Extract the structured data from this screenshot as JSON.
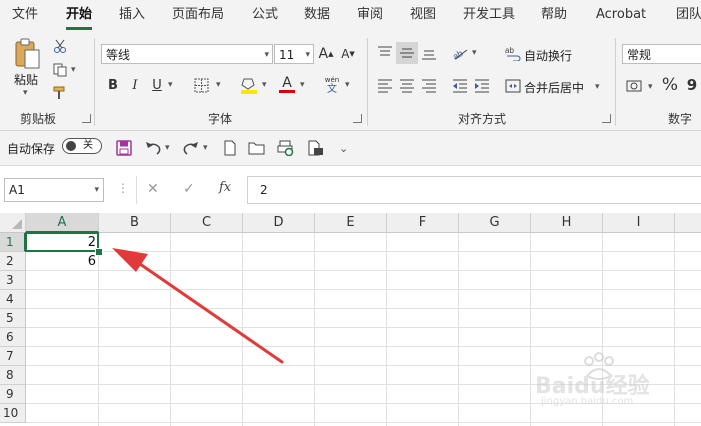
{
  "ribbon_tabs": [
    "文件",
    "开始",
    "插入",
    "页面布局",
    "公式",
    "数据",
    "审阅",
    "视图",
    "开发工具",
    "帮助",
    "Acrobat",
    "团队"
  ],
  "active_tab": "开始",
  "clipboard": {
    "paste_label": "粘贴",
    "group_label": "剪贴板"
  },
  "font": {
    "name": "等线",
    "size": "11",
    "group_label": "字体",
    "bold": "B",
    "italic": "I",
    "underline": "U",
    "font_color_glyph": "A",
    "wen_label": "wén",
    "wen_char": "文",
    "grow": "A",
    "shrink": "A"
  },
  "alignment": {
    "wrap_label": "自动换行",
    "merge_label": "合并后居中",
    "group_label": "对齐方式"
  },
  "number": {
    "format": "常规",
    "group_label": "数字",
    "percent": "%",
    "comma": "9"
  },
  "qat": {
    "autosave_label": "自动保存",
    "toggle_state": "关"
  },
  "formula_bar": {
    "name_box": "A1",
    "fx": "fx",
    "formula": "2",
    "cancel": "✕",
    "enter": "✓"
  },
  "columns": [
    "A",
    "B",
    "C",
    "D",
    "E",
    "F",
    "G",
    "H",
    "I"
  ],
  "rows": [
    "1",
    "2",
    "3",
    "4",
    "5",
    "6",
    "7",
    "8",
    "9",
    "10"
  ],
  "cells": [
    {
      "ref": "A1",
      "value": "2"
    },
    {
      "ref": "A2",
      "value": "6"
    }
  ],
  "colors": {
    "accent": "#217346",
    "arrow": "#e03a3a",
    "highlight": "#ffe600",
    "font_red": "#e00000",
    "save_purple": "#a4339b"
  },
  "watermark": {
    "text": "Baidu经验",
    "url": "jingyan.baidu.com"
  }
}
